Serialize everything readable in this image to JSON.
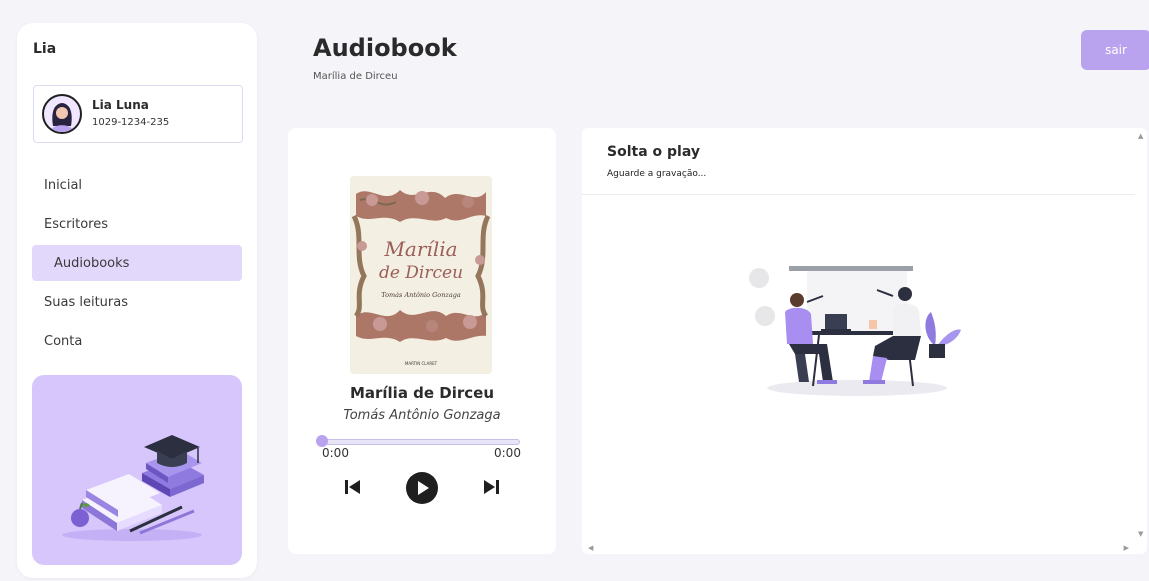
{
  "sidebar": {
    "brand": "Lia",
    "user": {
      "name": "Lia Luna",
      "id": "1029-1234-235"
    },
    "items": [
      {
        "label": "Inicial"
      },
      {
        "label": "Escritores"
      },
      {
        "label": "Audiobooks"
      },
      {
        "label": "Suas leituras"
      },
      {
        "label": "Conta"
      }
    ],
    "active_index": 2
  },
  "header": {
    "title": "Audiobook",
    "subtitle": "Marília de Dirceu",
    "logout_label": "sair"
  },
  "player": {
    "cover_title": "Marília de Dirceu",
    "cover_author": "Tomás Antônio Gonzaga",
    "cover_art_title_line1": "Marília",
    "cover_art_title_line2": "de Dirceu",
    "cover_art_author": "Tomás Antônio Gonzaga",
    "publisher_mark": "MARTIN CLARET",
    "current_time": "0:00",
    "total_time": "0:00",
    "progress": 0,
    "controls": {
      "previous": "skip-previous-icon",
      "play": "play-icon",
      "next": "skip-next-icon"
    }
  },
  "media": {
    "title": "Solta o play",
    "status": "Aguarde a gravação..."
  },
  "colors": {
    "accent": "#b9a3ee",
    "accent_light": "#e2d8fb",
    "promo_bg": "#d6c6fb",
    "background": "#f4f4f9"
  }
}
